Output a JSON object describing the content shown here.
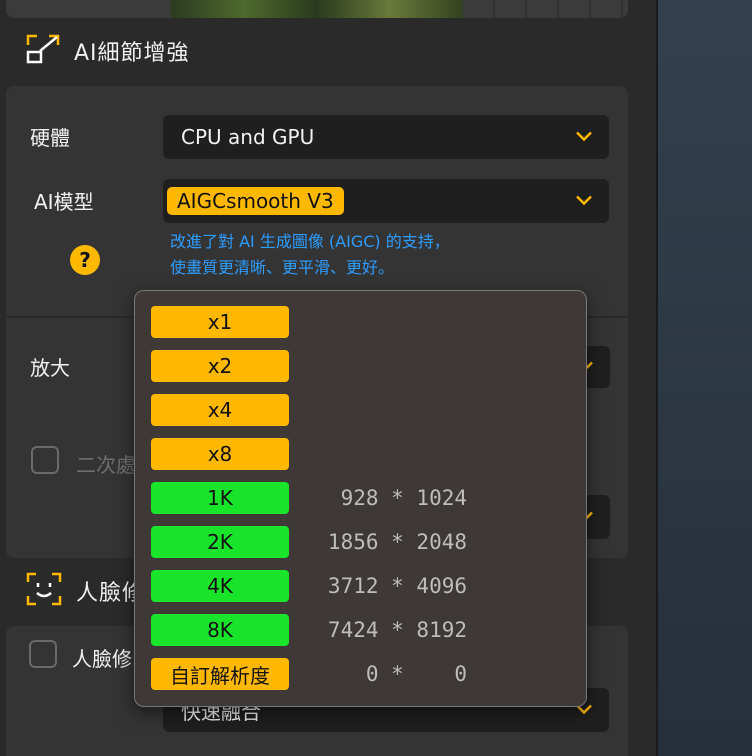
{
  "ai_detail": {
    "title": "AI細節增強",
    "hardware_label": "硬體",
    "hardware_value": "CPU and GPU",
    "model_label": "AI模型",
    "model_value": "AIGCsmooth  V3",
    "model_desc_line1": "改進了對 AI 生成圖像 (AIGC) 的支持，",
    "model_desc_line2": "使畫質更清晰、更平滑、更好。",
    "help_icon": "?"
  },
  "upscale": {
    "label": "放大",
    "secondary_checkbox_label": "二次處"
  },
  "face": {
    "title": "人臉修",
    "checkbox_label": "人臉修",
    "select_value": "快速融合"
  },
  "scale_menu": {
    "items": [
      {
        "label": "x1",
        "color": "yellow",
        "resolution": ""
      },
      {
        "label": "x2",
        "color": "yellow",
        "resolution": ""
      },
      {
        "label": "x4",
        "color": "yellow",
        "resolution": ""
      },
      {
        "label": "x8",
        "color": "yellow",
        "resolution": ""
      },
      {
        "label": "1K",
        "color": "green",
        "resolution": " 928 * 1024"
      },
      {
        "label": "2K",
        "color": "green",
        "resolution": "1856 * 2048"
      },
      {
        "label": "4K",
        "color": "green",
        "resolution": "3712 * 4096"
      },
      {
        "label": "8K",
        "color": "green",
        "resolution": "7424 * 8192"
      },
      {
        "label": "自訂解析度",
        "color": "yellow",
        "resolution": "   0 *    0"
      }
    ]
  },
  "colors": {
    "accent_yellow": "#ffb800",
    "accent_green": "#18e42a",
    "link_blue": "#2d9cff"
  }
}
